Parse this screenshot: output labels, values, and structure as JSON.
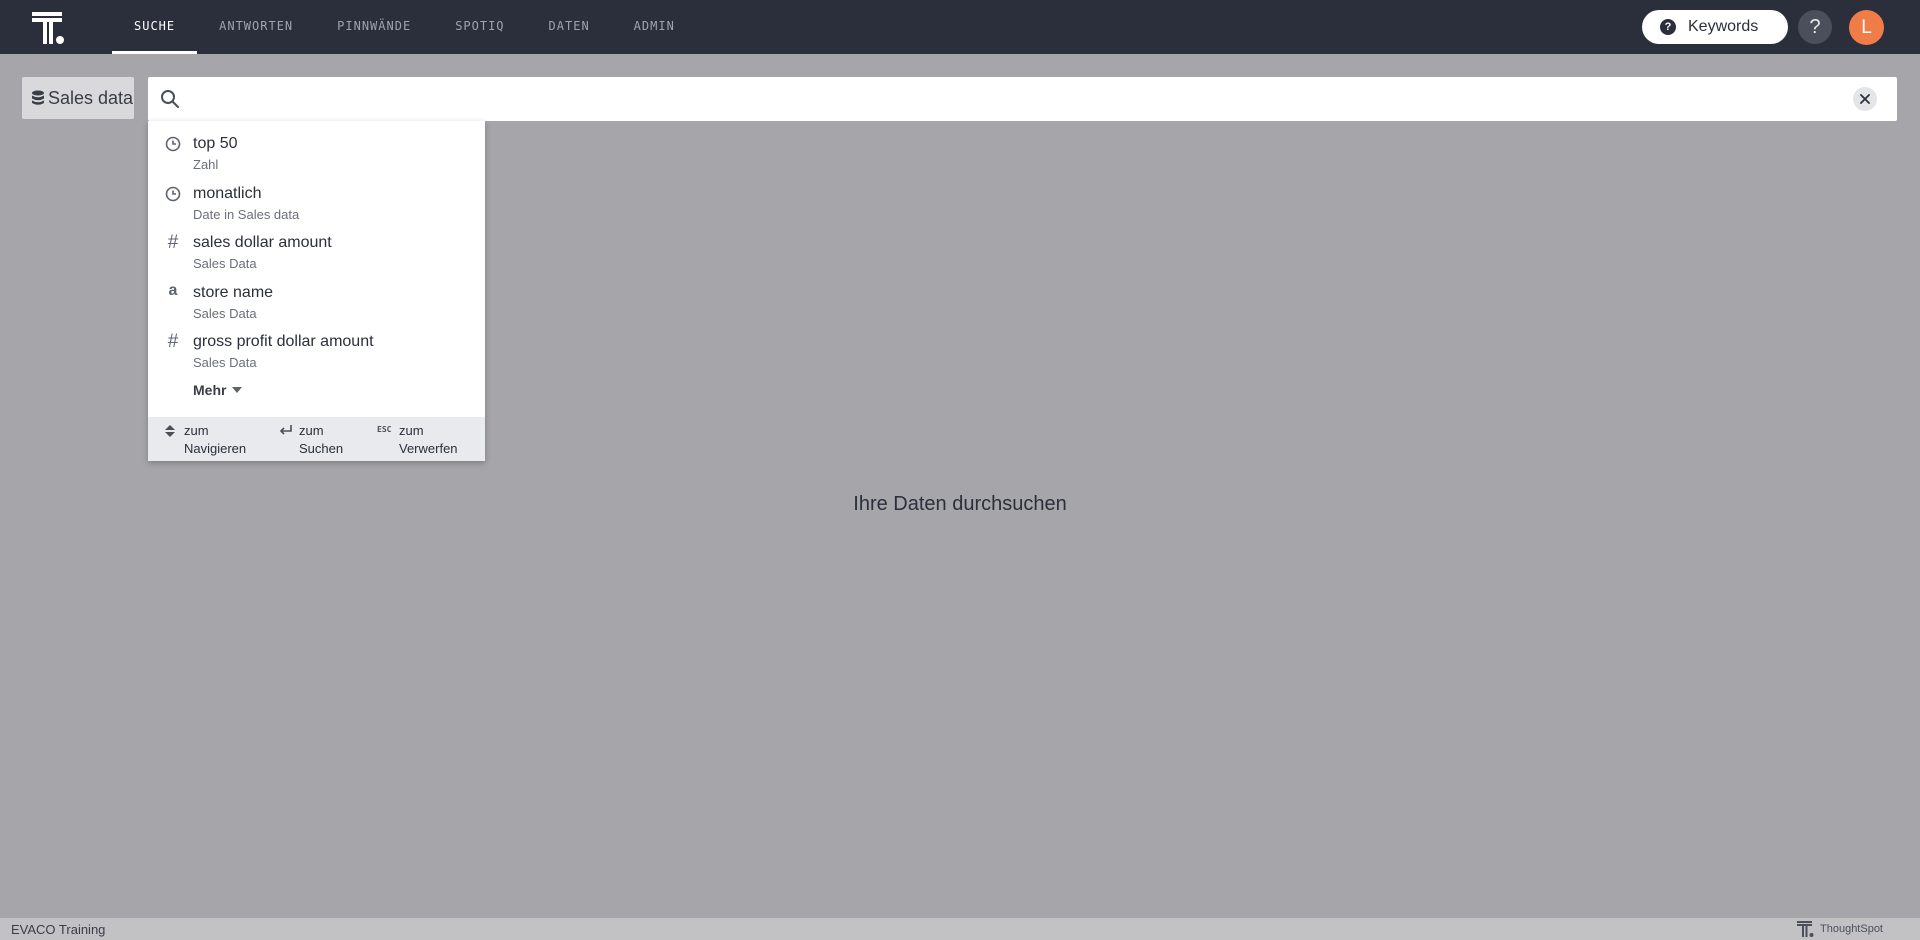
{
  "nav": {
    "tabs": [
      {
        "label": "SUCHE",
        "active": true
      },
      {
        "label": "ANTWORTEN",
        "active": false
      },
      {
        "label": "PINNWÄNDE",
        "active": false
      },
      {
        "label": "SPOTIQ",
        "active": false
      },
      {
        "label": "DATEN",
        "active": false
      },
      {
        "label": "ADMIN",
        "active": false
      }
    ],
    "keywords_label": "Keywords",
    "help_label": "?",
    "avatar_initial": "L"
  },
  "search": {
    "source_label": "Sales data",
    "query": "",
    "placeholder": ""
  },
  "suggestions": {
    "items": [
      {
        "icon": "clock-icon",
        "title": "top 50",
        "subtitle": "Zahl"
      },
      {
        "icon": "clock-icon",
        "title": "monatlich",
        "subtitle": "Date in Sales data"
      },
      {
        "icon": "hash-icon",
        "title": "sales dollar amount",
        "subtitle": "Sales Data"
      },
      {
        "icon": "text-attribute-icon",
        "title": "store name",
        "subtitle": "Sales Data"
      },
      {
        "icon": "hash-icon",
        "title": "gross profit dollar amount",
        "subtitle": "Sales Data"
      }
    ],
    "more_label": "Mehr",
    "hints": {
      "navigate_line1": "zum",
      "navigate_line2": "Navigieren",
      "search_line1": "zum",
      "search_line2": "Suchen",
      "dismiss_key": "ESC",
      "dismiss_line1": "zum",
      "dismiss_line2": "Verwerfen"
    }
  },
  "main": {
    "empty_message": "Ihre Daten durchsuchen"
  },
  "footer": {
    "org_name": "EVACO Training",
    "brand": "ThoughtSpot"
  },
  "colors": {
    "topbar": "#2b2f3b",
    "backdrop": "#a6a6aa",
    "avatar": "#f07c47"
  }
}
